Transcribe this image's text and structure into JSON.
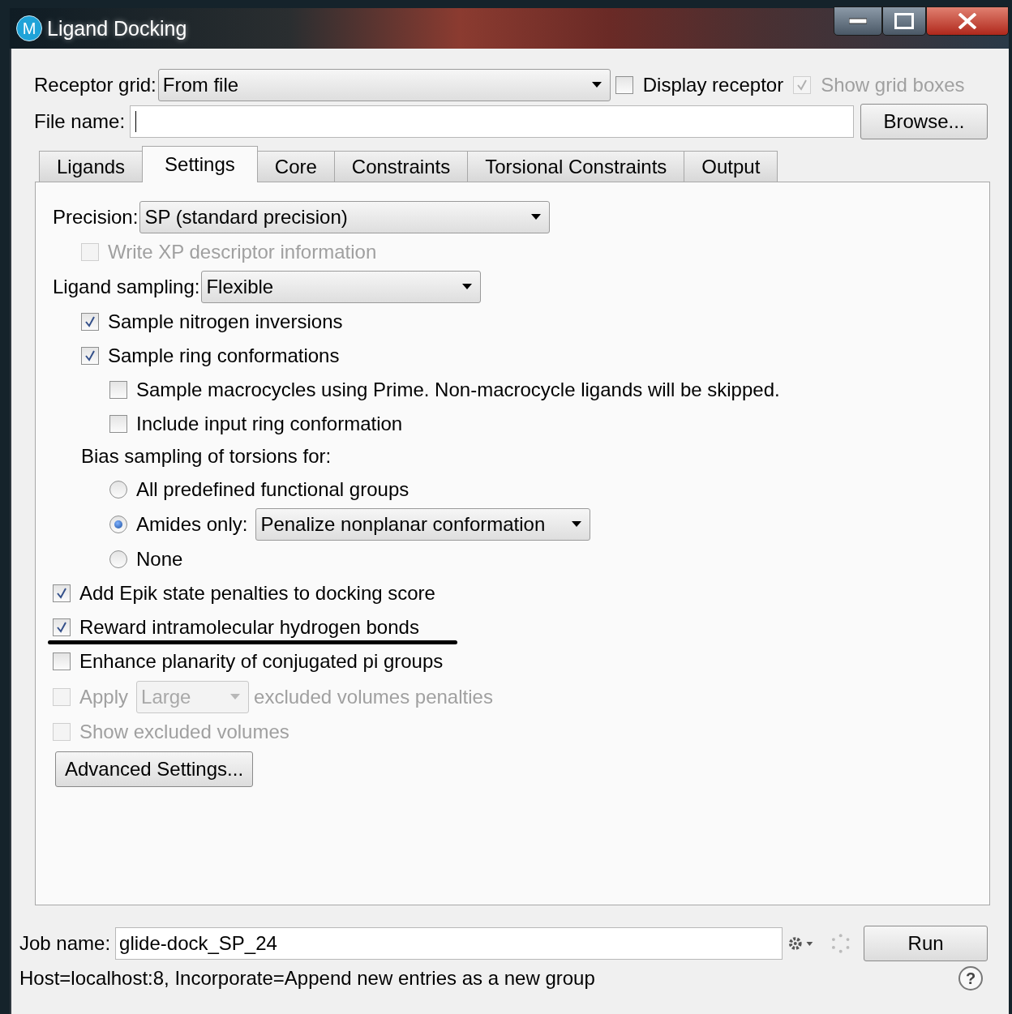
{
  "window": {
    "title": "Ligand Docking",
    "app_icon": "M"
  },
  "receptor_grid": {
    "label": "Receptor grid:",
    "value": "From file"
  },
  "display_receptor": {
    "label": "Display receptor",
    "checked": false,
    "disabled": false
  },
  "show_grid_boxes": {
    "label": "Show grid boxes",
    "checked": true,
    "disabled": true
  },
  "file_name": {
    "label": "File name:"
  },
  "browse_button": "Browse...",
  "tabs": [
    {
      "label": "Ligands",
      "selected": false
    },
    {
      "label": "Settings",
      "selected": true
    },
    {
      "label": "Core",
      "selected": false
    },
    {
      "label": "Constraints",
      "selected": false
    },
    {
      "label": "Torsional Constraints",
      "selected": false
    },
    {
      "label": "Output",
      "selected": false
    }
  ],
  "settings": [
    {
      "kind": "combo",
      "label": "Precision:",
      "value": "SP (standard precision)",
      "children": [
        {
          "kind": "check",
          "label": "Write XP descriptor information",
          "checked": false,
          "disabled": true,
          "underlined": false
        }
      ]
    },
    {
      "kind": "combo",
      "label": "Ligand sampling:",
      "value": "Flexible",
      "children": [
        {
          "kind": "check",
          "label": "Sample nitrogen inversions",
          "checked": true,
          "disabled": false,
          "underlined": false
        },
        {
          "kind": "check",
          "label": "Sample ring conformations",
          "checked": true,
          "disabled": false,
          "underlined": false,
          "children": [
            {
              "kind": "check",
              "label": "Sample macrocycles using Prime. Non-macrocycle ligands will be skipped.",
              "checked": false,
              "disabled": false,
              "underlined": false
            },
            {
              "kind": "check",
              "label": "Include input ring conformation",
              "checked": false,
              "disabled": false,
              "underlined": false
            }
          ]
        },
        {
          "kind": "heading",
          "label": "Bias sampling of torsions for:",
          "children": [
            {
              "kind": "radio",
              "label": "All predefined functional groups",
              "selected": false
            },
            {
              "kind": "radio",
              "label": "Amides only:",
              "selected": true,
              "value": "Penalize nonplanar conformation"
            },
            {
              "kind": "radio",
              "label": "None",
              "selected": false
            }
          ]
        }
      ]
    },
    {
      "kind": "check",
      "label": "Add Epik state penalties to docking score",
      "checked": true,
      "disabled": false,
      "underlined": false
    },
    {
      "kind": "check",
      "label": "Reward intramolecular hydrogen bonds",
      "checked": true,
      "disabled": false,
      "underlined": true
    },
    {
      "kind": "check",
      "label": "Enhance planarity of conjugated pi groups",
      "checked": false,
      "disabled": false,
      "underlined": false
    },
    {
      "kind": "check_combo",
      "label": "Apply",
      "checked": false,
      "disabled": true,
      "value": "Large",
      "after": "excluded volumes penalties"
    },
    {
      "kind": "check",
      "label": "Show excluded volumes",
      "checked": false,
      "disabled": true,
      "underlined": false
    },
    {
      "kind": "button",
      "label": "Advanced Settings..."
    }
  ],
  "job_name": {
    "label": "Job name:",
    "value": "glide-dock_SP_24"
  },
  "run_button": "Run",
  "status": "Host=localhost:8, Incorporate=Append new entries as a new group",
  "help": "?"
}
